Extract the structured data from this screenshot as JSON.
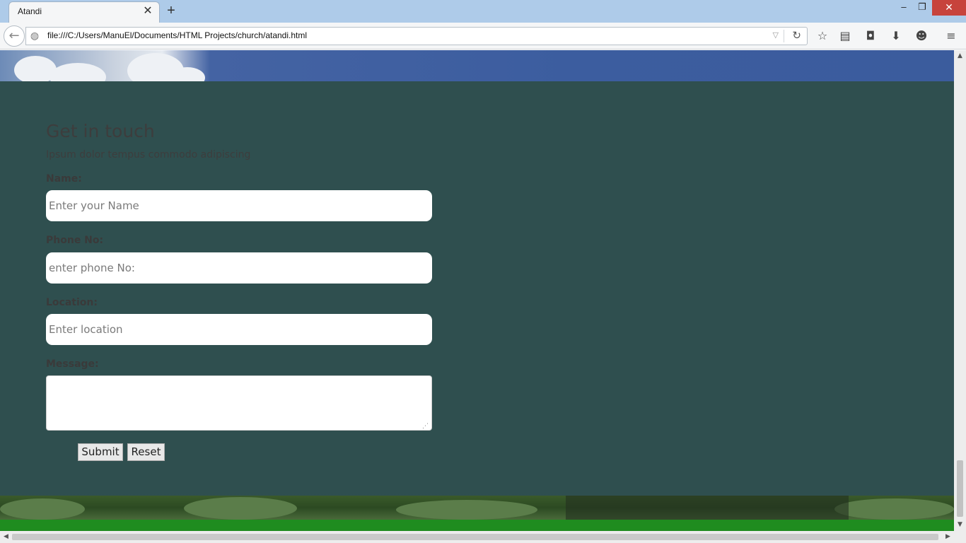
{
  "browser": {
    "tab_title": "Atandi",
    "tab_close_glyph": "✕",
    "new_tab_glyph": "+",
    "minimize_glyph": "–",
    "maximize_glyph": "❐",
    "close_glyph": "✕",
    "back_glyph": "←",
    "globe_glyph": "◍",
    "url": "file:///C:/Users/ManuEl/Documents/HTML Projects/church/atandi.html",
    "dropdown_glyph": "▽",
    "reload_glyph": "↻",
    "toolbar_icons": {
      "bookmark": "☆",
      "reading_list": "▤",
      "pocket": "◘",
      "downloads": "⬇",
      "hello": "☻",
      "menu": "≡"
    }
  },
  "contact": {
    "heading": "Get in touch",
    "subtext": "Ipsum dolor tempus commodo adipiscing",
    "name_label": "Name:",
    "name_placeholder": "Enter your Name",
    "phone_label": "Phone No:",
    "phone_placeholder": "enter phone No:",
    "location_label": "Location:",
    "location_placeholder": "Enter location",
    "message_label": "Message:",
    "message_value": "",
    "submit_label": "Submit",
    "reset_label": "Reset"
  },
  "scrollbars": {
    "up": "▲",
    "down": "▼",
    "left": "◀",
    "right": "▶"
  },
  "colors": {
    "section_bg": "#2f4f4f",
    "footer_green": "#1f8c1f",
    "titlebar": "#aecbe9",
    "close_red": "#c7433c"
  }
}
